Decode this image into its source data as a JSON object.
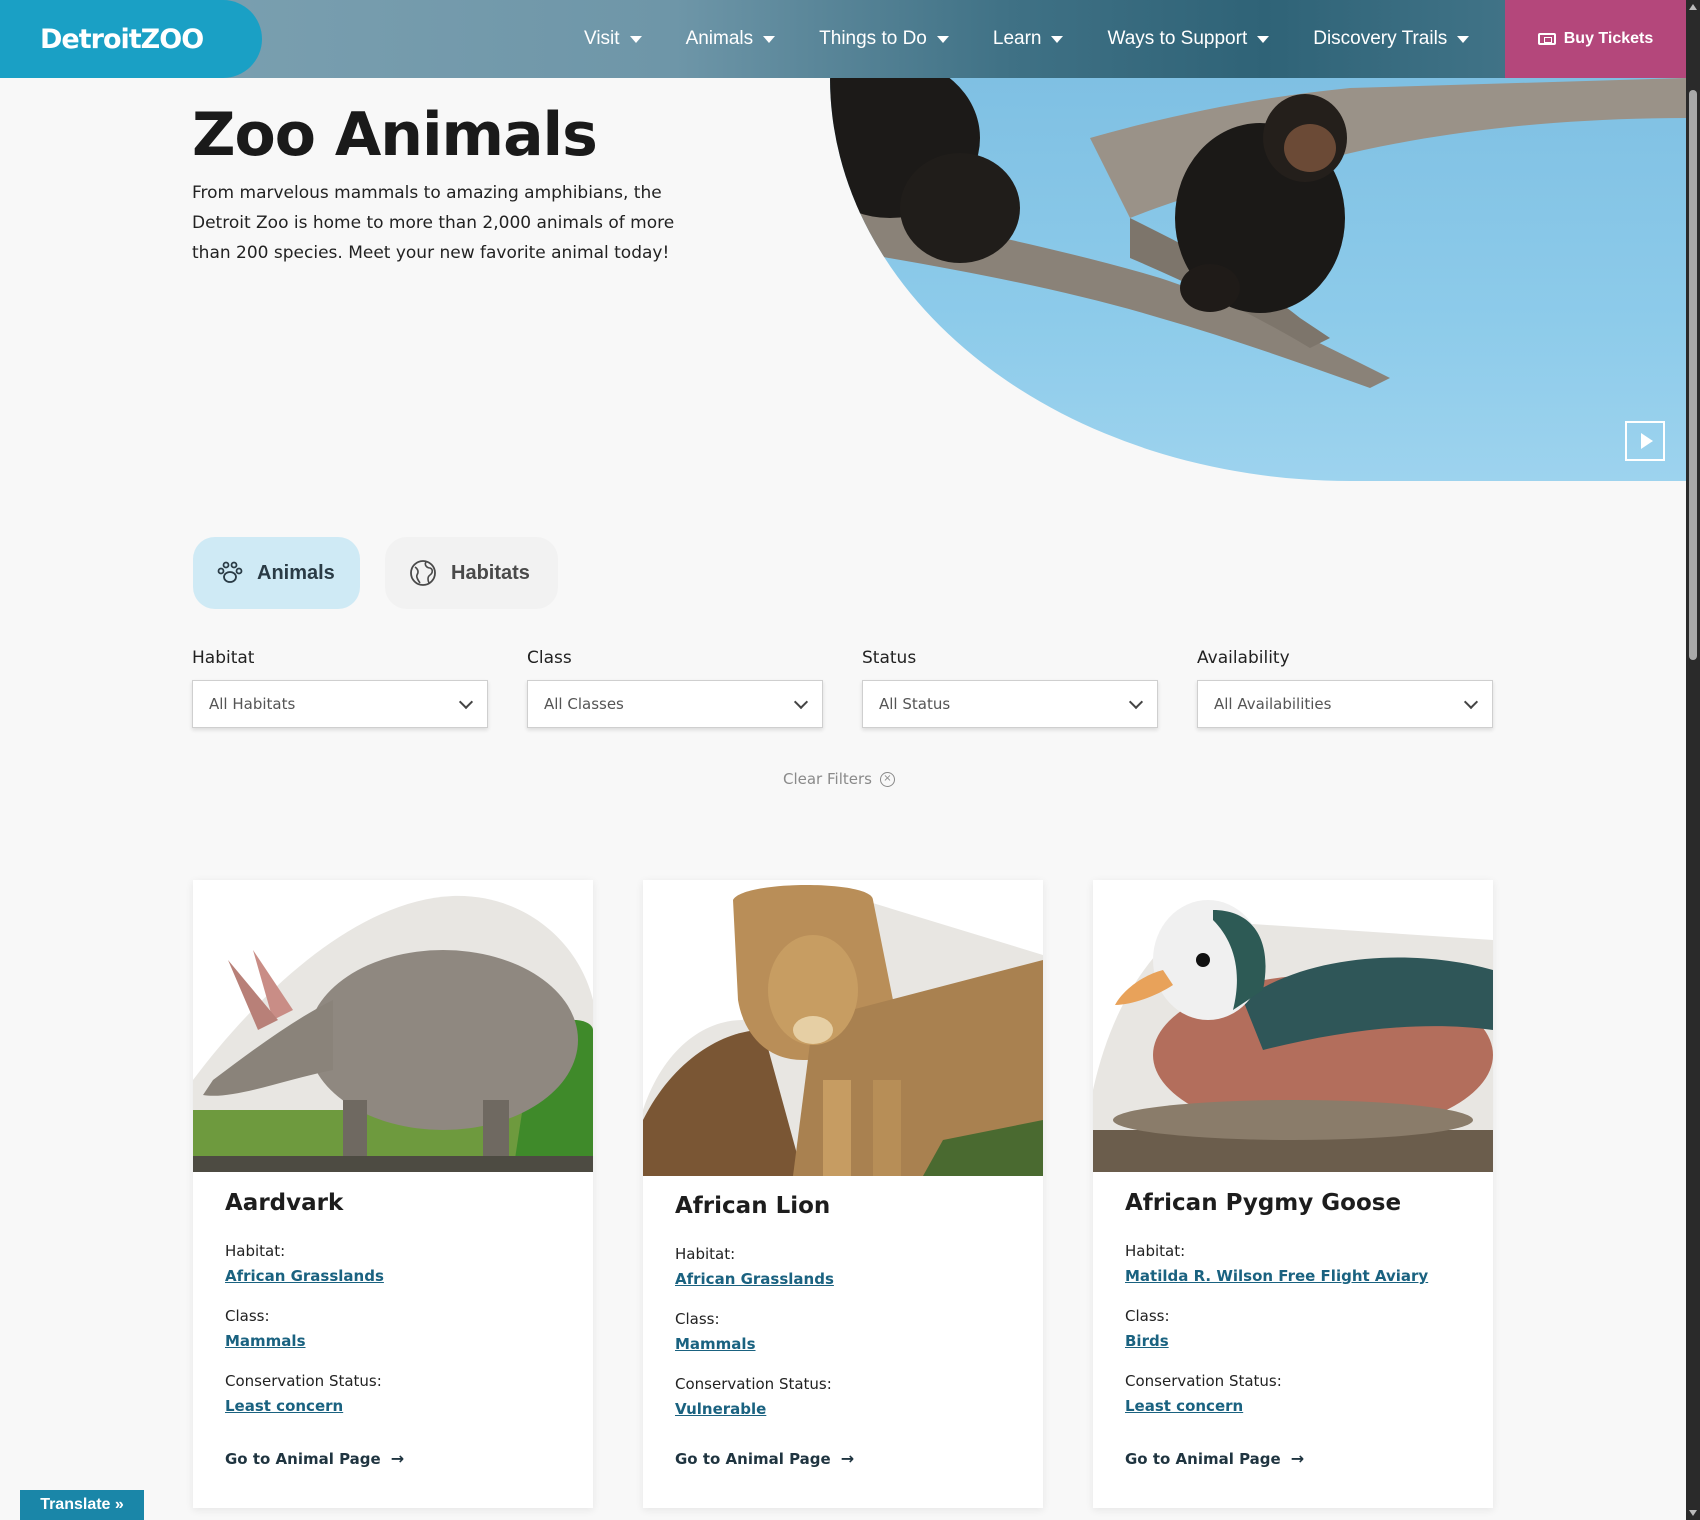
{
  "header": {
    "logo_text": "DetroitZOO",
    "nav": [
      {
        "label": "Visit"
      },
      {
        "label": "Animals"
      },
      {
        "label": "Things to Do"
      },
      {
        "label": "Learn"
      },
      {
        "label": "Ways to Support"
      },
      {
        "label": "Discovery Trails"
      }
    ],
    "buy_tickets": "Buy Tickets"
  },
  "hero": {
    "title": "Zoo Animals",
    "text": "From marvelous mammals to amazing amphibians, the Detroit Zoo is home to more than 2,000 animals of more than 200 species. Meet your new favorite animal today!"
  },
  "tabs": [
    {
      "label": "Animals",
      "icon": "paw-icon",
      "active": true
    },
    {
      "label": "Habitats",
      "icon": "globe-icon",
      "active": false
    }
  ],
  "filters": [
    {
      "label": "Habitat",
      "value": "All Habitats"
    },
    {
      "label": "Class",
      "value": "All Classes"
    },
    {
      "label": "Status",
      "value": "All Status"
    },
    {
      "label": "Availability",
      "value": "All Availabilities"
    }
  ],
  "clear_filters": "Clear Filters",
  "cards": [
    {
      "name": "Aardvark",
      "habitat_label": "Habitat:",
      "habitat": "African Grasslands",
      "class_label": "Class:",
      "class": "Mammals",
      "status_label": "Conservation Status:",
      "status": "Least concern",
      "link": "Go to Animal Page"
    },
    {
      "name": "African Lion",
      "habitat_label": "Habitat:",
      "habitat": "African Grasslands",
      "class_label": "Class:",
      "class": "Mammals",
      "status_label": "Conservation Status:",
      "status": "Vulnerable",
      "link": "Go to Animal Page"
    },
    {
      "name": "African Pygmy Goose",
      "habitat_label": "Habitat:",
      "habitat": "Matilda R. Wilson Free Flight Aviary",
      "class_label": "Class:",
      "class": "Birds",
      "status_label": "Conservation Status:",
      "status": "Least concern",
      "link": "Go to Animal Page"
    }
  ],
  "translate": "Translate »",
  "colors": {
    "brand": "#1aa0c5",
    "tickets": "#b4477b",
    "link": "#1a6280"
  }
}
